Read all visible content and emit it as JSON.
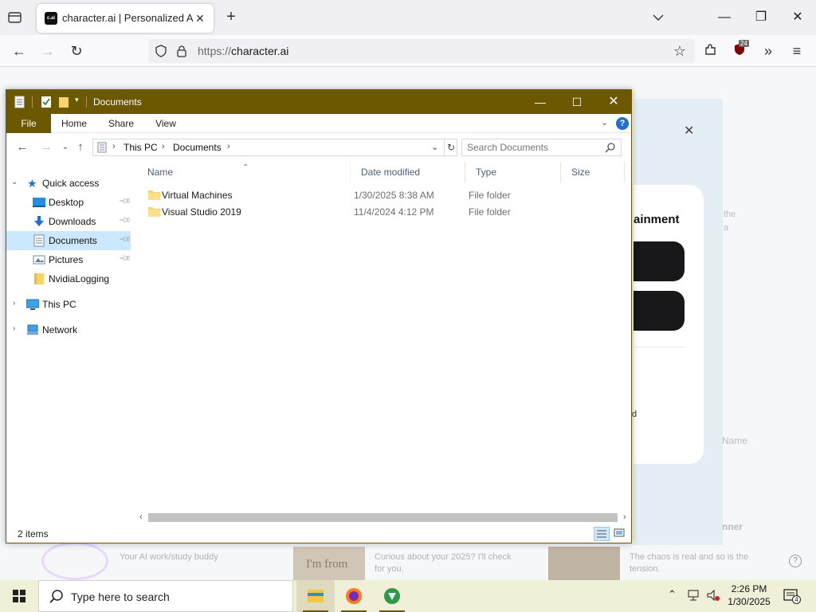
{
  "browser": {
    "tab_title": "character.ai | Personalized AI fo",
    "favicon_text": "c.ai",
    "url_protocol": "https://",
    "url_host": "character.ai",
    "extension_badge": "24"
  },
  "page": {
    "continue_title": "ainment",
    "ghost_text_1": "the",
    "ghost_text_2": "a",
    "modal_line_text": "d",
    "ghost_name": "Name",
    "ghost_banner": "nner",
    "feed": [
      {
        "text": "Your AI work/study buddy"
      },
      {
        "text": "Curious about your 2025? I'll check for you."
      },
      {
        "text": "The chaos is real and so is the tension."
      }
    ],
    "thumb_text": "I'm from",
    "help_glyph": "?"
  },
  "explorer": {
    "title": "Documents",
    "ribbon_tabs": [
      "File",
      "Home",
      "Share",
      "View"
    ],
    "address": {
      "crumbs": [
        "This PC",
        "Documents"
      ]
    },
    "search_placeholder": "Search Documents",
    "nav": {
      "quick_access": "Quick access",
      "items": [
        {
          "label": "Desktop",
          "pinned": true
        },
        {
          "label": "Downloads",
          "pinned": true
        },
        {
          "label": "Documents",
          "pinned": true,
          "selected": true
        },
        {
          "label": "Pictures",
          "pinned": true
        },
        {
          "label": "NvidiaLogging",
          "pinned": false
        }
      ],
      "this_pc": "This PC",
      "network": "Network"
    },
    "columns": [
      "Name",
      "Date modified",
      "Type",
      "Size"
    ],
    "rows": [
      {
        "name": "Virtual Machines",
        "date": "1/30/2025 8:38 AM",
        "type": "File folder",
        "size": ""
      },
      {
        "name": "Visual Studio 2019",
        "date": "11/4/2024 4:12 PM",
        "type": "File folder",
        "size": ""
      }
    ],
    "status_count": "2 items",
    "accent": "#6b5800"
  },
  "taskbar": {
    "search_placeholder": "Type here to search",
    "time": "2:26 PM",
    "date": "1/30/2025",
    "notification_count": "4"
  }
}
